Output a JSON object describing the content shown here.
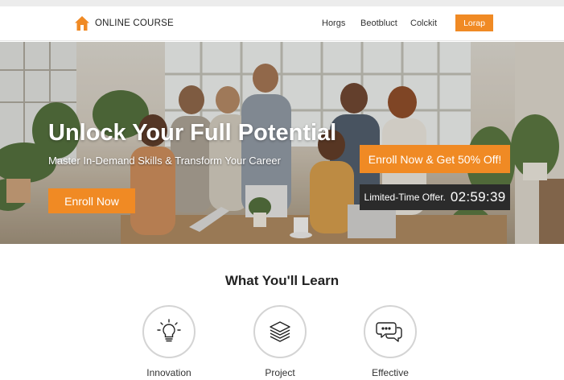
{
  "nav": {
    "brand": "ONLINE COURSE",
    "links": [
      "Horgs",
      "Beotbluct",
      "Colckit"
    ],
    "button": "Lorap"
  },
  "hero": {
    "title": "Unlock Your Full Potential",
    "subtitle": "Master In-Demand Skills & Transform Your Career",
    "cta": "Enroll Now",
    "offer_cta": "Enroll Now & Get 50% Off!",
    "timer_label": "Limited-Time Offer.",
    "timer_value": "02:59:39"
  },
  "learn": {
    "title": "What You'll Learn",
    "features": [
      {
        "label": "Innovation",
        "icon": "lightbulb-icon"
      },
      {
        "label": "Project",
        "icon": "layers-icon"
      },
      {
        "label": "Effective",
        "icon": "chat-bubbles-icon"
      }
    ]
  },
  "colors": {
    "accent": "#f08a24",
    "timer_bg": "#2b2b2b"
  }
}
